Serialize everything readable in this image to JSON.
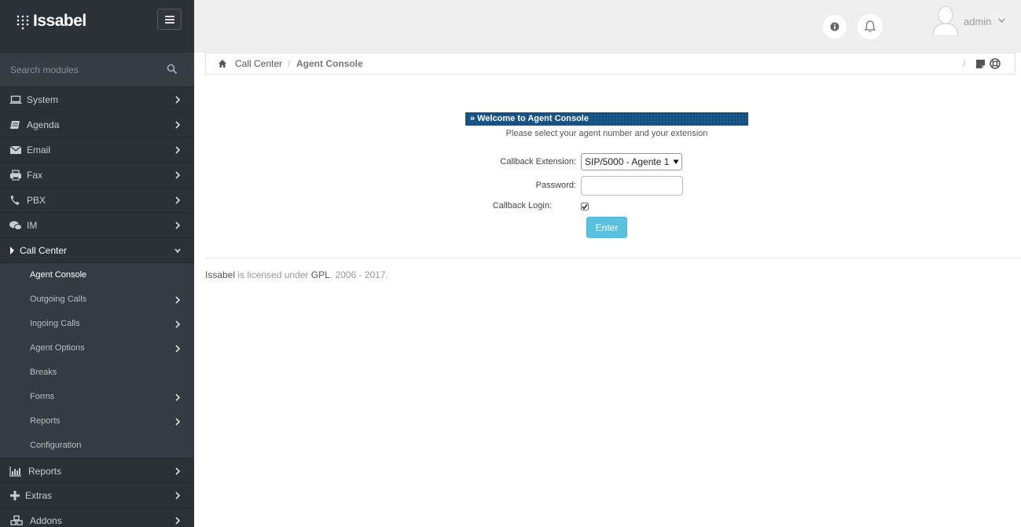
{
  "brand": {
    "name": "Issabel"
  },
  "search": {
    "placeholder": "Search modules"
  },
  "sidebar": {
    "items": [
      {
        "label": "System",
        "icon": "laptop-icon"
      },
      {
        "label": "Agenda",
        "icon": "book-icon"
      },
      {
        "label": "Email",
        "icon": "envelope-icon"
      },
      {
        "label": "Fax",
        "icon": "printer-icon"
      },
      {
        "label": "PBX",
        "icon": "phone-icon"
      },
      {
        "label": "IM",
        "icon": "chat-icon"
      },
      {
        "label": "Call Center",
        "icon": "caret-right-icon",
        "expanded": true
      },
      {
        "label": "Reports",
        "icon": "bar-chart-icon"
      },
      {
        "label": "Extras",
        "icon": "plus-icon"
      },
      {
        "label": "Addons",
        "icon": "cubes-icon"
      }
    ],
    "subitems": [
      {
        "label": "Agent Console",
        "active": true,
        "has_children": false
      },
      {
        "label": "Outgoing Calls",
        "has_children": true
      },
      {
        "label": "Ingoing Calls",
        "has_children": true
      },
      {
        "label": "Agent Options",
        "has_children": true
      },
      {
        "label": "Breaks",
        "has_children": false
      },
      {
        "label": "Forms",
        "has_children": true
      },
      {
        "label": "Reports",
        "has_children": true
      },
      {
        "label": "Configuration",
        "has_children": false
      }
    ]
  },
  "header": {
    "user": "admin"
  },
  "breadcrumb": {
    "items": [
      "Call Center",
      "Agent Console"
    ],
    "separator": "/"
  },
  "console": {
    "title": "» Welcome to Agent Console",
    "subtitle": "Please select your agent number and your extension",
    "extension_label": "Callback Extension:",
    "extension_value": "SIP/5000 - Agente 1",
    "password_label": "Password:",
    "callback_login_label": "Callback Login:",
    "callback_login_checked": true,
    "enter_label": "Enter"
  },
  "footer": {
    "brand": "Issabel",
    "middle": " is licensed under ",
    "license": "GPL",
    "years": ". 2006 - 2017."
  },
  "colors": {
    "sidebar_bg": "#2b3137",
    "welcome_bar": "#0b4a7f",
    "enter_button": "#5bc0de",
    "topbar_bg": "#efefef"
  }
}
